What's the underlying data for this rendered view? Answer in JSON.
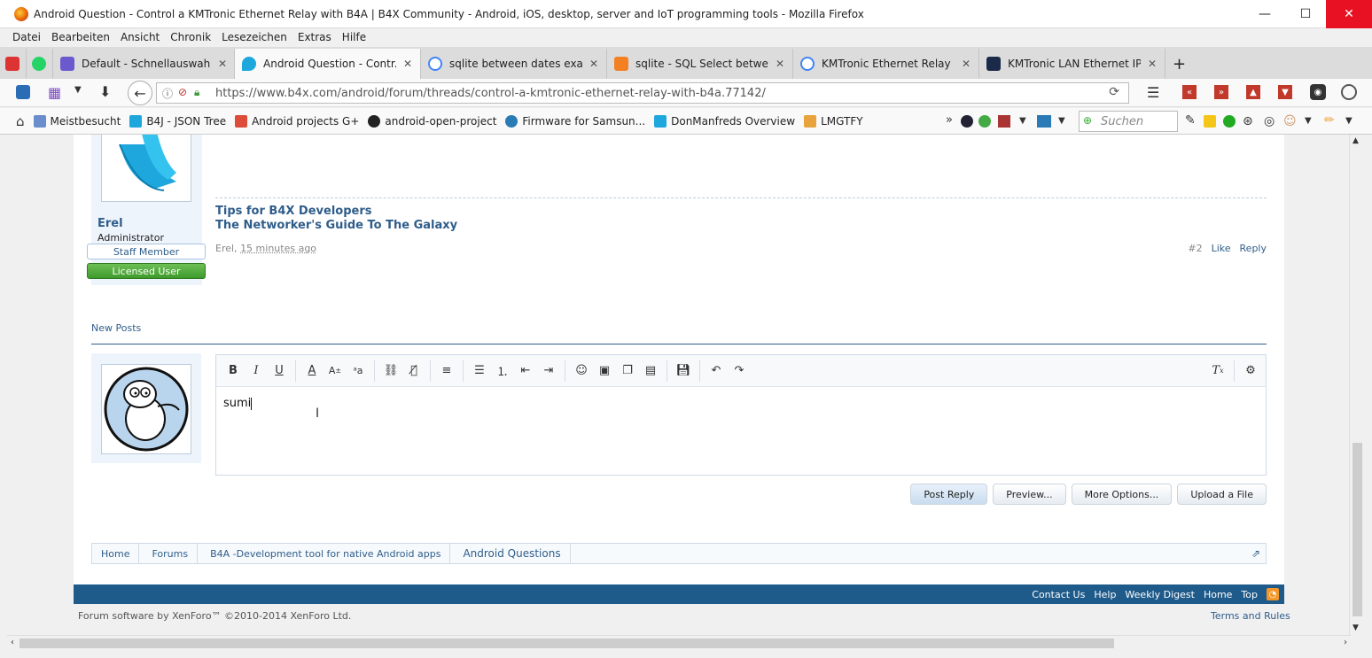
{
  "window": {
    "title": "Android Question - Control a KMTronic Ethernet Relay with B4A | B4X Community - Android, iOS, desktop, server and IoT programming tools - Mozilla Firefox",
    "minimize": "—",
    "maximize": "☐",
    "close": "✕"
  },
  "menu": [
    "Datei",
    "Bearbeiten",
    "Ansicht",
    "Chronik",
    "Lesezeichen",
    "Extras",
    "Hilfe"
  ],
  "tabs": [
    {
      "label": "Default - Schnellauswahl",
      "color": "#6a5acd"
    },
    {
      "label": "Android Question - Contr...",
      "color": "#1ea7dd"
    },
    {
      "label": "sqlite between dates exam...",
      "color": "#4285f4"
    },
    {
      "label": "sqlite - SQL Select betwee...",
      "color": "#f48024"
    },
    {
      "label": "KMTronic Ethernet Relay -...",
      "color": "#4285f4"
    },
    {
      "label": "KMTronic LAN Ethernet IP...",
      "color": "#1b2a49"
    }
  ],
  "new_tab": "+",
  "url": "https://www.b4x.com/android/forum/threads/control-a-kmtronic-ethernet-relay-with-b4a.77142/",
  "bookmarks": [
    "Meistbesucht",
    "B4J - JSON Tree",
    "Android projects G+",
    "android-open-project",
    "Firmware for Samsun...",
    "DonManfreds Overview",
    "LMGTFY"
  ],
  "bookmarks_more": "»",
  "search_placeholder": "Suchen",
  "post": {
    "username": "Erel",
    "user_title": "Administrator",
    "banner_staff": "Staff Member",
    "banner_licensed": "Licensed User",
    "signature_1": "Tips for B4X Developers",
    "signature_2": "The Networker's Guide To The Galaxy",
    "author": "Erel,",
    "time": "15 minutes ago",
    "number": "#2",
    "like": "Like",
    "reply": "Reply"
  },
  "new_posts": "New Posts",
  "editor_text": "sumi",
  "buttons": {
    "post_reply": "Post Reply",
    "preview": "Preview...",
    "more_options": "More Options...",
    "upload": "Upload a File"
  },
  "breadcrumb": [
    "Home",
    "Forums",
    "B4A -Development tool for native Android apps",
    "Android Questions"
  ],
  "footer_links": [
    "Contact Us",
    "Help",
    "Weekly Digest",
    "Home",
    "Top"
  ],
  "copyright": "Forum software by XenForo™ ©2010-2014 XenForo Ltd.",
  "terms": "Terms and Rules",
  "colors": {
    "accent": "#1e5a8a",
    "link": "#2f5d8a",
    "licensed": "#3e9a2b"
  }
}
